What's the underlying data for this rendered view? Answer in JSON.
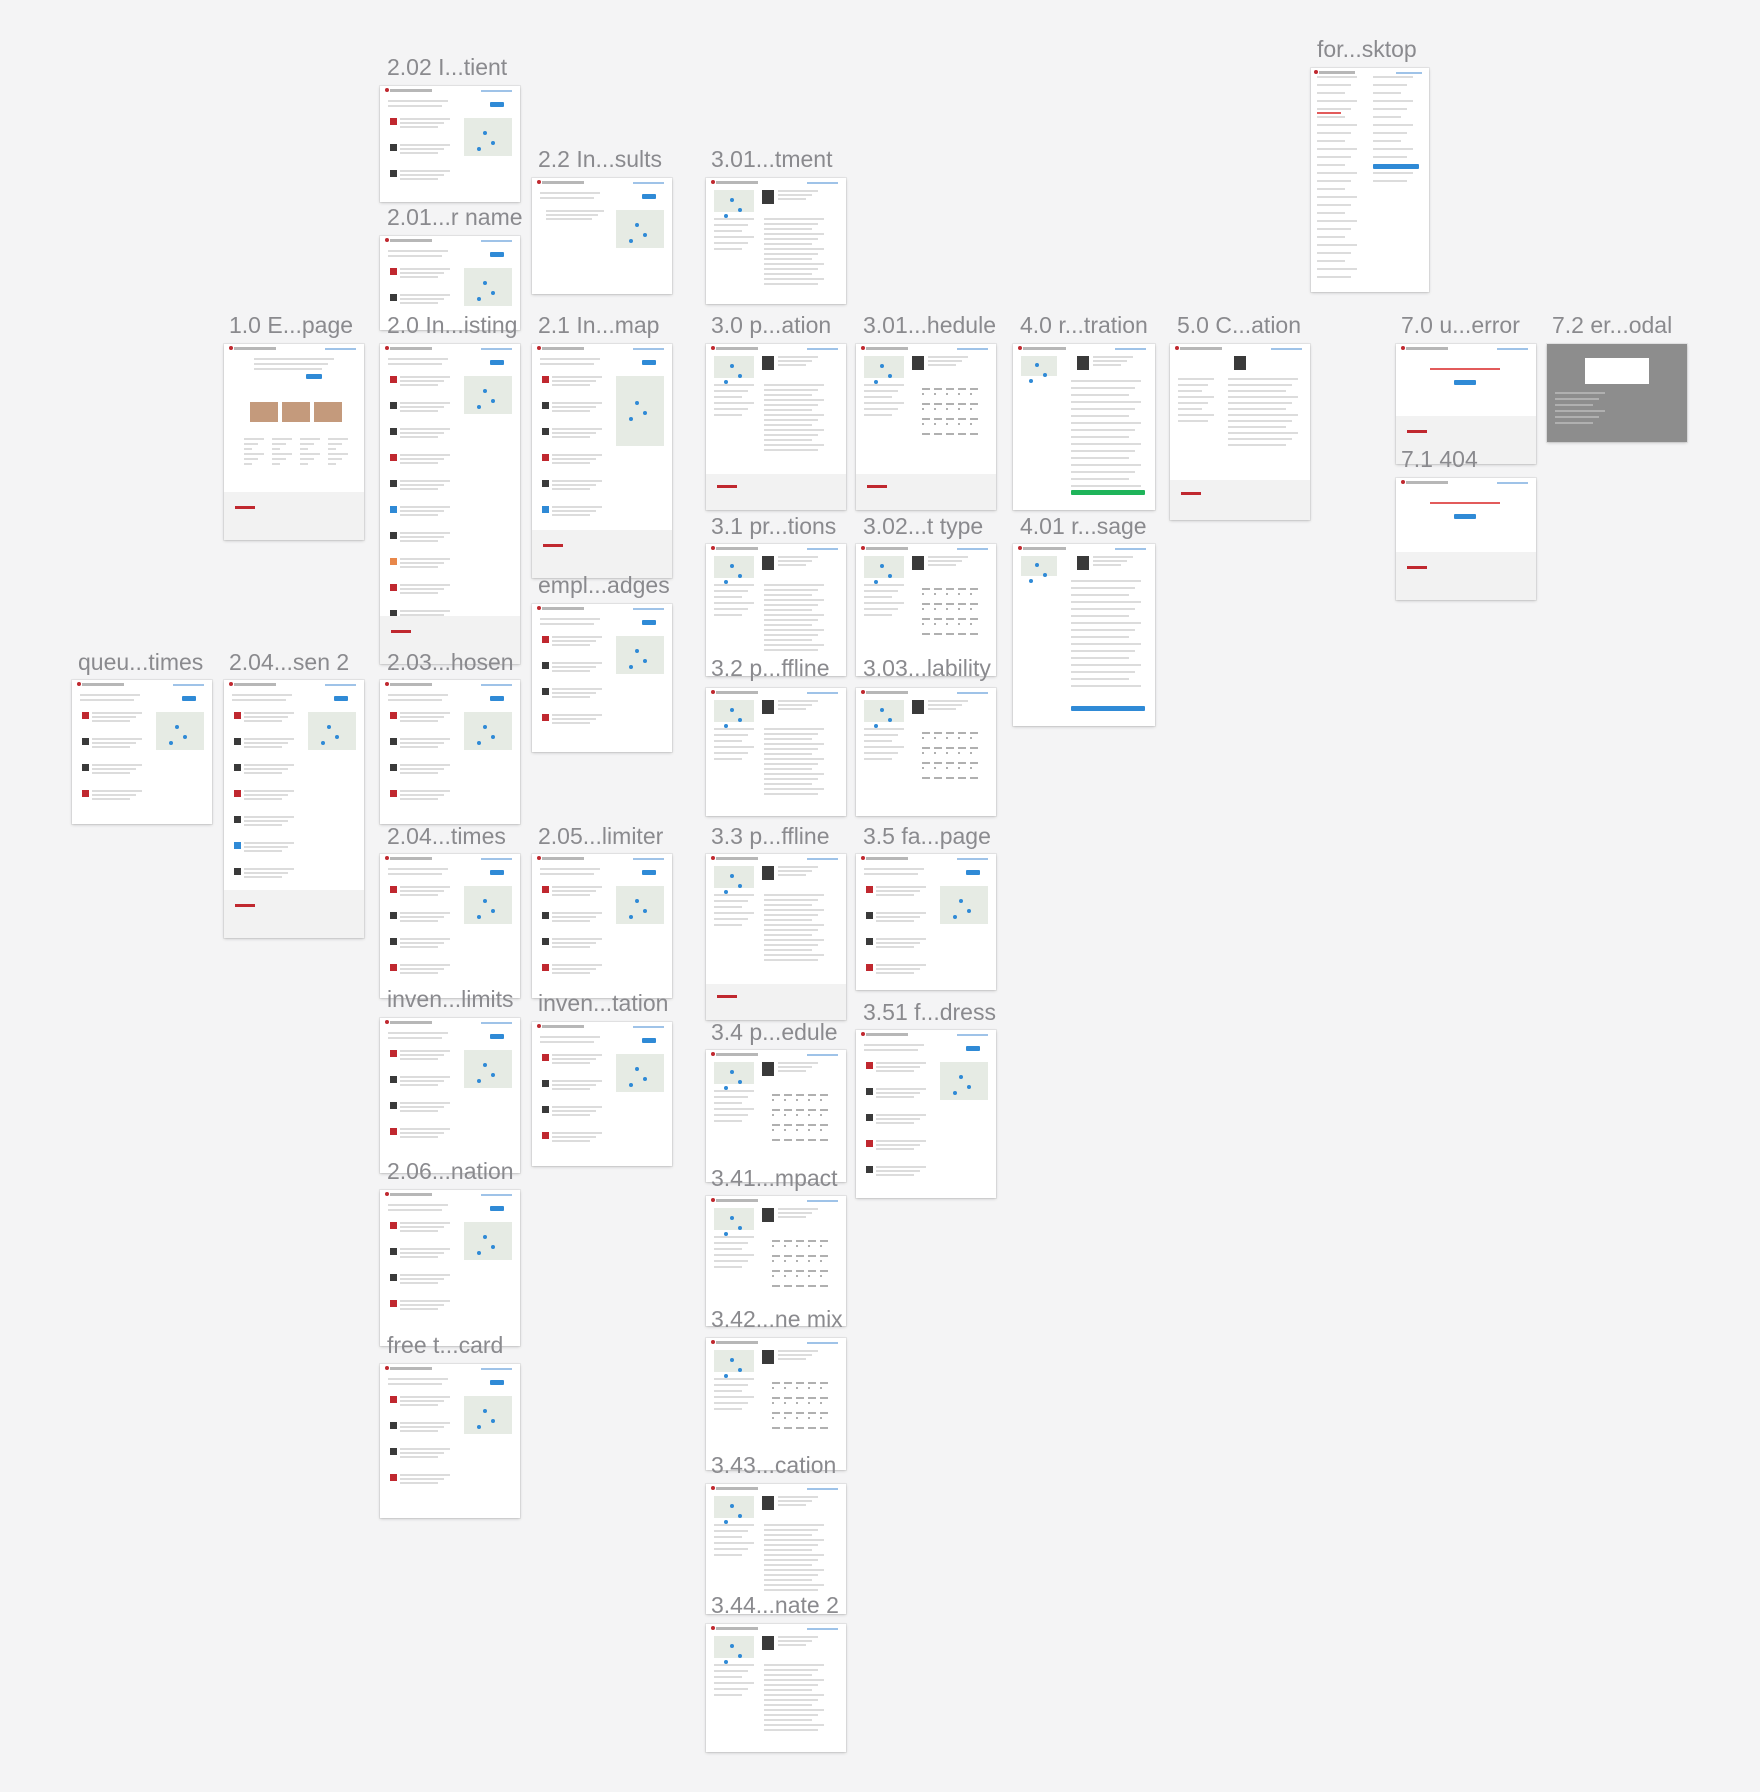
{
  "canvas": {
    "background": "#f4f4f5",
    "accent_blue": "#2f8ad6",
    "brand_red": "#c0282f",
    "label_color": "#8a8a8e"
  },
  "artboards": [
    {
      "id": "ab-202",
      "label": "2.02 I...tient",
      "variant": "listing"
    },
    {
      "id": "ab-201",
      "label": "2.01...r name",
      "variant": "listing"
    },
    {
      "id": "ab-20",
      "label": "2.0 In...isting",
      "variant": "listing-long"
    },
    {
      "id": "ab-203",
      "label": "2.03...hosen",
      "variant": "listing"
    },
    {
      "id": "ab-204t",
      "label": "2.04...times",
      "variant": "listing"
    },
    {
      "id": "ab-invlim",
      "label": "inven...limits",
      "variant": "listing"
    },
    {
      "id": "ab-206",
      "label": "2.06...nation",
      "variant": "listing"
    },
    {
      "id": "ab-free",
      "label": "free t...card",
      "variant": "listing"
    },
    {
      "id": "ab-22",
      "label": "2.2 In...sults",
      "variant": "empty"
    },
    {
      "id": "ab-21",
      "label": "2.1 In...map",
      "variant": "map"
    },
    {
      "id": "ab-empl",
      "label": "empl...adges",
      "variant": "listing"
    },
    {
      "id": "ab-205",
      "label": "2.05...limiter",
      "variant": "listing"
    },
    {
      "id": "ab-invtat",
      "label": "inven...tation",
      "variant": "listing"
    },
    {
      "id": "ab-10",
      "label": "1.0 E...page",
      "variant": "landing"
    },
    {
      "id": "ab-queu",
      "label": "queu...times",
      "variant": "listing"
    },
    {
      "id": "ab-204s",
      "label": "2.04...sen 2",
      "variant": "listing-long"
    },
    {
      "id": "ab-301t",
      "label": "3.01...tment",
      "variant": "profile"
    },
    {
      "id": "ab-30",
      "label": "3.0 p...ation",
      "variant": "profile-footer"
    },
    {
      "id": "ab-31",
      "label": "3.1 pr...tions",
      "variant": "profile"
    },
    {
      "id": "ab-32",
      "label": "3.2 p...ffline",
      "variant": "profile"
    },
    {
      "id": "ab-33",
      "label": "3.3 p...ffline",
      "variant": "profile-footer"
    },
    {
      "id": "ab-34",
      "label": "3.4 p...edule",
      "variant": "schedule"
    },
    {
      "id": "ab-341",
      "label": "3.41...mpact",
      "variant": "schedule"
    },
    {
      "id": "ab-342",
      "label": "3.42...ne mix",
      "variant": "schedule"
    },
    {
      "id": "ab-343",
      "label": "3.43...cation",
      "variant": "profile"
    },
    {
      "id": "ab-344",
      "label": "3.44...nate 2",
      "variant": "profile"
    },
    {
      "id": "ab-301h",
      "label": "3.01...hedule",
      "variant": "schedule-footer"
    },
    {
      "id": "ab-302",
      "label": "3.02...t type",
      "variant": "schedule"
    },
    {
      "id": "ab-303",
      "label": "3.03...lability",
      "variant": "schedule"
    },
    {
      "id": "ab-35",
      "label": "3.5 fa...page",
      "variant": "listing"
    },
    {
      "id": "ab-351",
      "label": "3.51 f...dress",
      "variant": "listing"
    },
    {
      "id": "ab-40",
      "label": "4.0 r...tration",
      "variant": "form-green"
    },
    {
      "id": "ab-401",
      "label": "4.01 r...sage",
      "variant": "form"
    },
    {
      "id": "ab-50",
      "label": "5.0 C...ation",
      "variant": "confirm"
    },
    {
      "id": "ab-for",
      "label": "for...sktop",
      "variant": "spec"
    },
    {
      "id": "ab-70",
      "label": "7.0 u...error",
      "variant": "error"
    },
    {
      "id": "ab-71",
      "label": "7.1 404",
      "variant": "error"
    },
    {
      "id": "ab-72",
      "label": "7.2 er...odal",
      "variant": "modal"
    }
  ]
}
